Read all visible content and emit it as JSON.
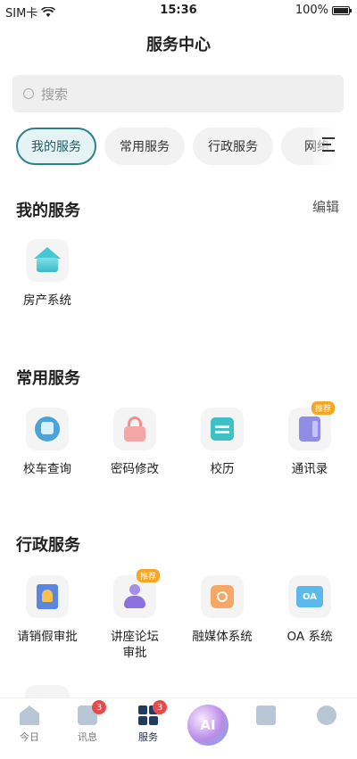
{
  "status_bar": {
    "carrier": "SIM卡",
    "time": "15:36",
    "battery": "100%"
  },
  "header": {
    "title": "服务中心"
  },
  "search": {
    "placeholder": "搜索"
  },
  "tabs": [
    {
      "label": "我的服务",
      "active": true
    },
    {
      "label": "常用服务",
      "active": false
    },
    {
      "label": "行政服务",
      "active": false
    },
    {
      "label": "网络",
      "active": false
    }
  ],
  "sections": {
    "my_services": {
      "title": "我的服务",
      "edit": "编辑",
      "items": [
        {
          "label": "房产系统",
          "icon": "house-icon"
        }
      ]
    },
    "common_services": {
      "title": "常用服务",
      "items": [
        {
          "label": "校车查询",
          "icon": "bus-icon"
        },
        {
          "label": "密码修改",
          "icon": "lock-icon"
        },
        {
          "label": "校历",
          "icon": "calendar-icon"
        },
        {
          "label": "通讯录",
          "icon": "contacts-icon",
          "badge": "推荐"
        }
      ]
    },
    "admin_services": {
      "title": "行政服务",
      "items": [
        {
          "label": "请销假审批",
          "icon": "leave-approval-icon"
        },
        {
          "label": "讲座论坛审批",
          "icon": "forum-approval-icon",
          "badge": "推荐"
        },
        {
          "label": "融媒体系统",
          "icon": "media-icon"
        },
        {
          "label": "OA 系统",
          "icon": "oa-icon",
          "icon_text": "OA"
        }
      ]
    }
  },
  "bottom_nav": [
    {
      "label": "今日",
      "icon": "home-icon"
    },
    {
      "label": "讯息",
      "icon": "message-icon",
      "badge": "3"
    },
    {
      "label": "服务",
      "icon": "services-grid-icon",
      "badge": "3",
      "active": true
    },
    {
      "label": "AI",
      "icon": "ai-icon"
    },
    {
      "label": "",
      "icon": "book-icon"
    },
    {
      "label": "",
      "icon": "user-icon"
    }
  ],
  "colors": {
    "accent": "#2f7f8c",
    "badge_red": "#e84a4a",
    "recommend_orange": "#f5a623"
  }
}
